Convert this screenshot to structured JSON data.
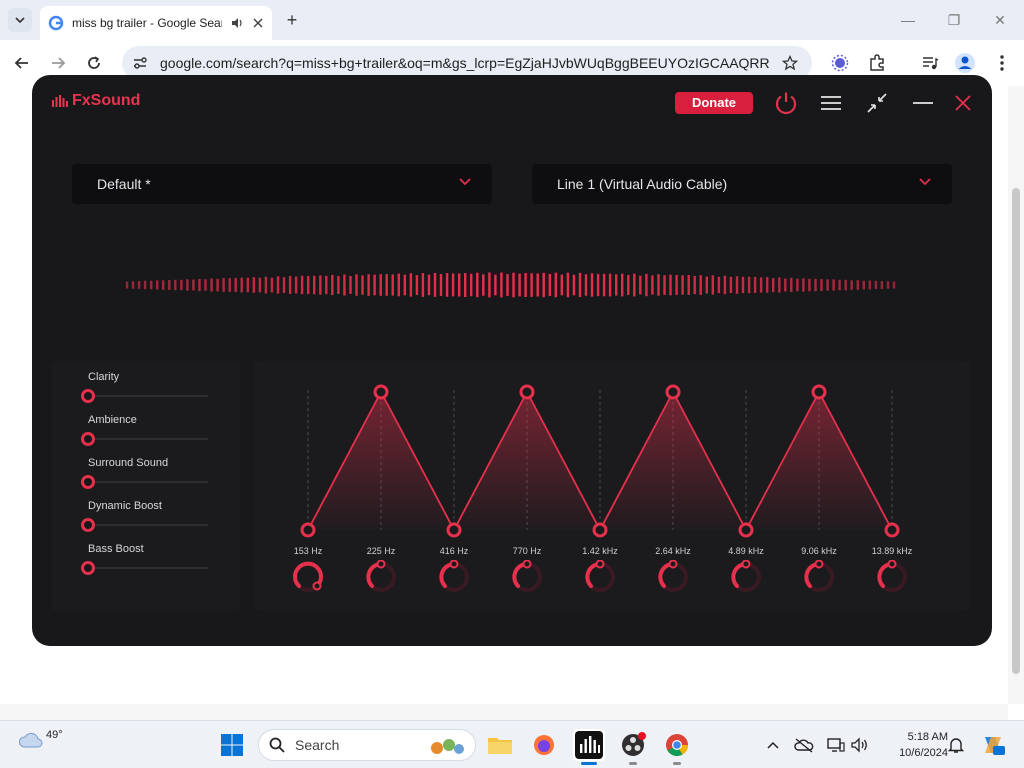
{
  "browser": {
    "tab": {
      "title": "miss bg trailer - Google Search"
    },
    "url": "google.com/search?q=miss+bg+trailer&oq=m&gs_lcrp=EgZjaHJvbWUqBggBEEUYOzIGCAAQRR..."
  },
  "fxsound": {
    "app_name": "FxSound",
    "donate_label": "Donate",
    "preset": "Default *",
    "output_device": "Line 1 (Virtual Audio Cable)",
    "accent_color": "#e6304c",
    "effects": [
      {
        "label": "Clarity",
        "value": 0
      },
      {
        "label": "Ambience",
        "value": 0
      },
      {
        "label": "Surround Sound",
        "value": 0
      },
      {
        "label": "Dynamic Boost",
        "value": 0
      },
      {
        "label": "Bass Boost",
        "value": 0
      }
    ],
    "eq_bands": [
      {
        "freq": "153 Hz",
        "level": 0
      },
      {
        "freq": "225 Hz",
        "level": 1
      },
      {
        "freq": "416 Hz",
        "level": 0
      },
      {
        "freq": "770 Hz",
        "level": 1
      },
      {
        "freq": "1.42 kHz",
        "level": 0
      },
      {
        "freq": "2.64 kHz",
        "level": 1
      },
      {
        "freq": "4.89 kHz",
        "level": 0
      },
      {
        "freq": "9.06 kHz",
        "level": 1
      },
      {
        "freq": "13.89 kHz",
        "level": 0
      }
    ]
  },
  "taskbar": {
    "weather_temp": "49°",
    "search_label": "Search",
    "time": "5:18 AM",
    "date": "10/6/2024"
  }
}
